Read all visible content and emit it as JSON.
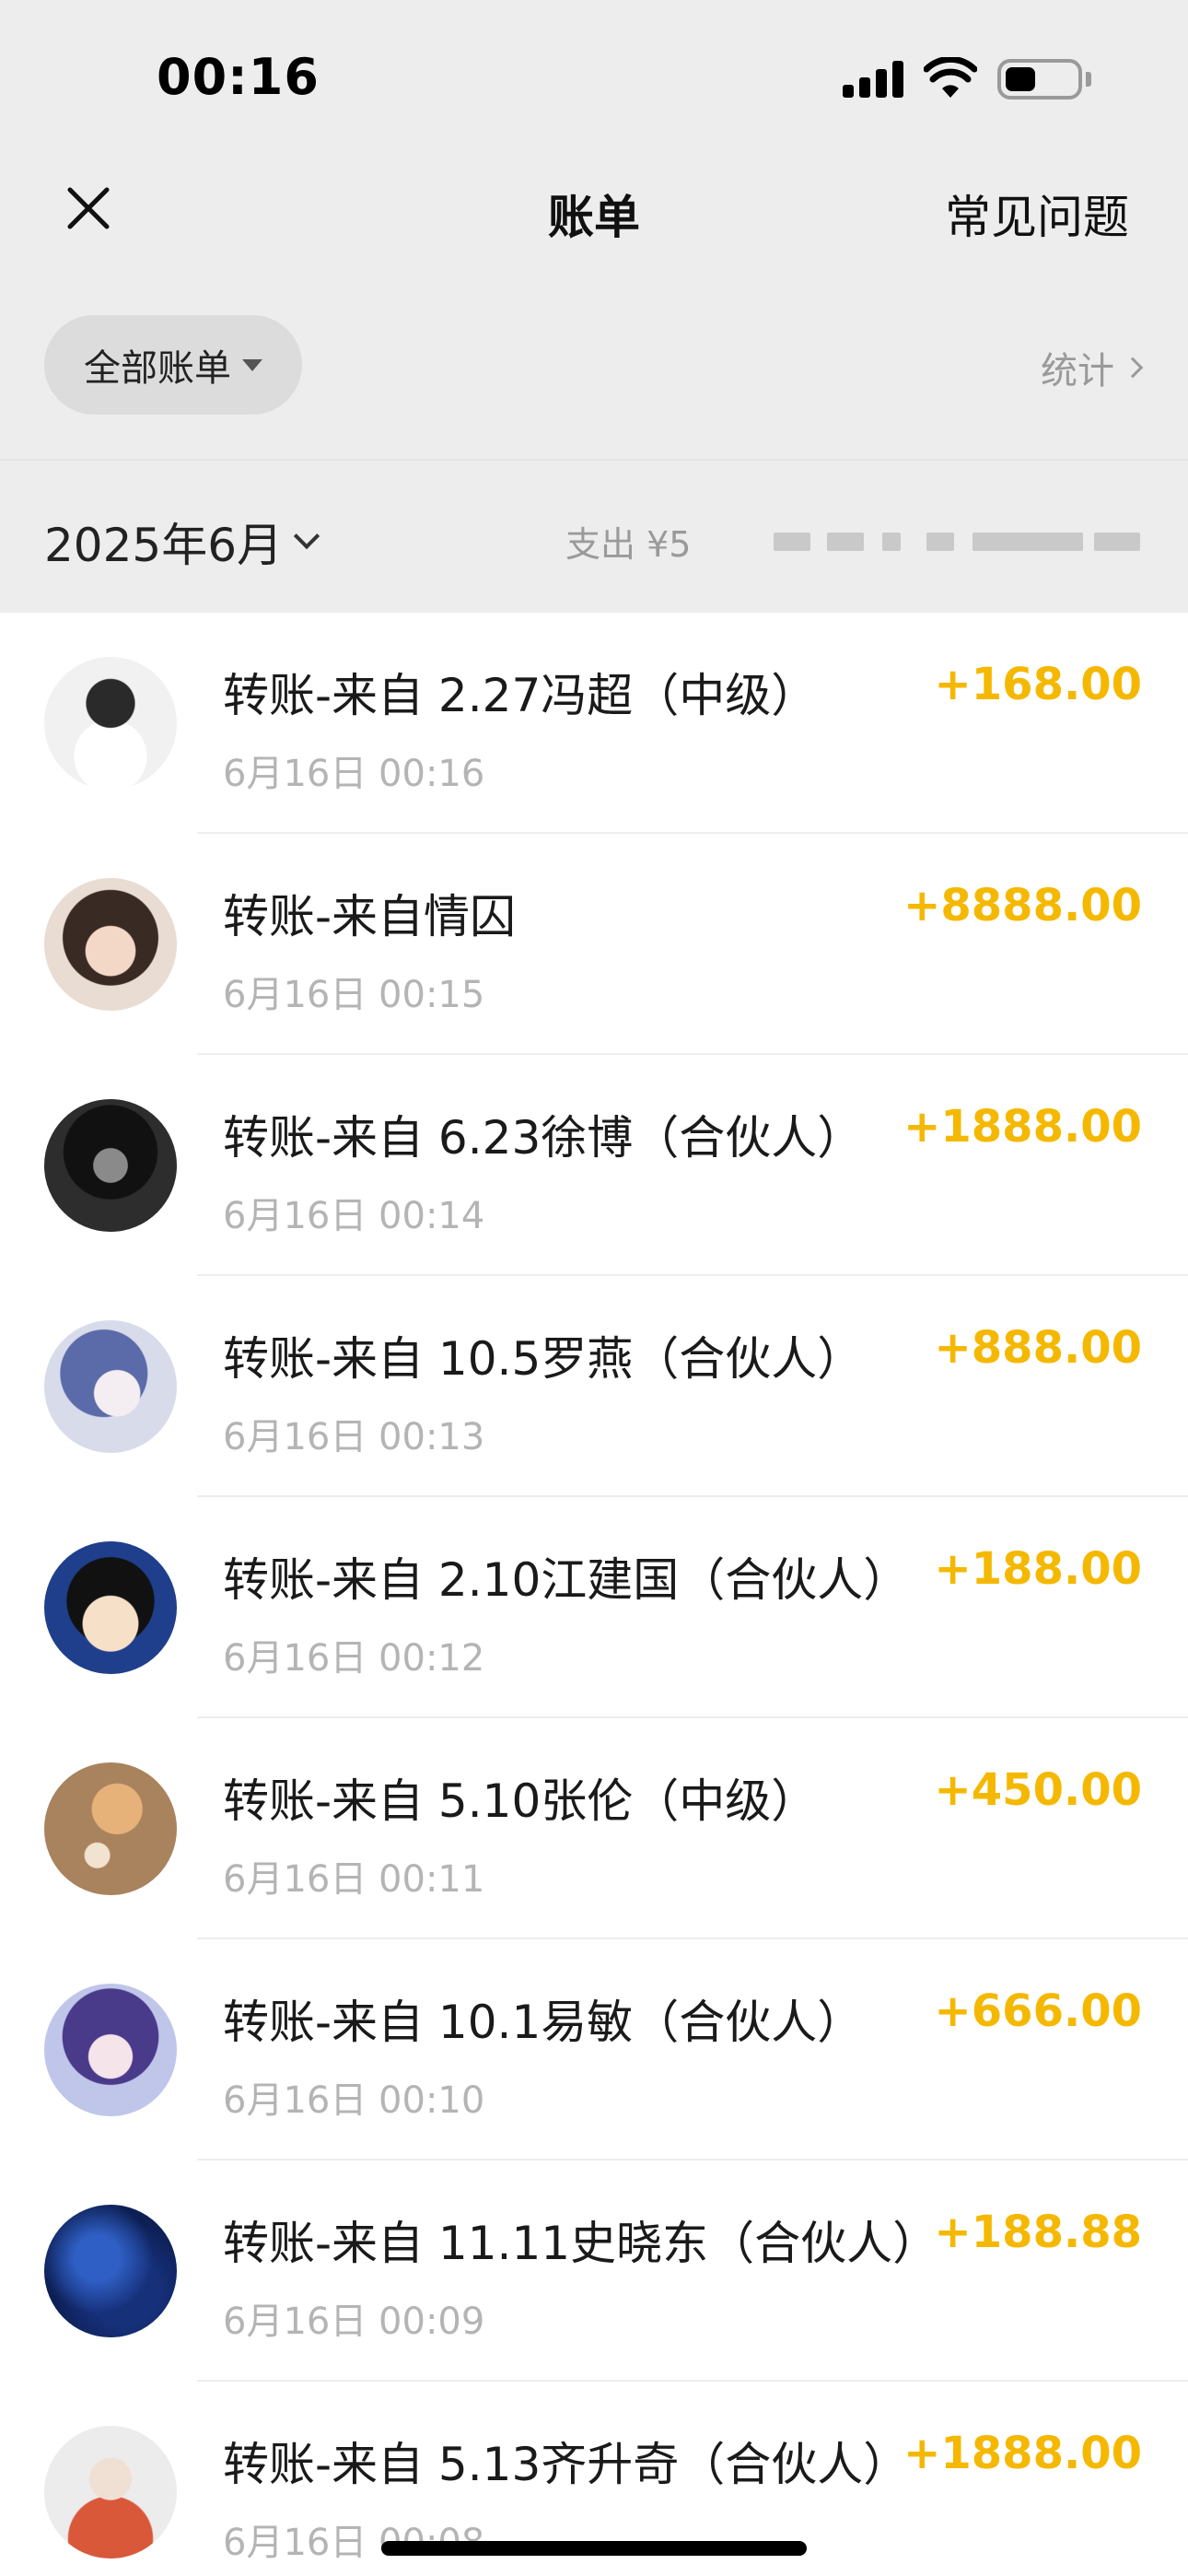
{
  "status_bar": {
    "time": "00:16"
  },
  "nav": {
    "title": "账单",
    "faq": "常见问题",
    "close_icon": "close-icon"
  },
  "filter": {
    "label": "全部账单",
    "stats": "统计"
  },
  "month": {
    "label": "2025年6月",
    "summary_prefix": "支出 ¥5"
  },
  "colors": {
    "amount": "#f5b800",
    "background_top": "#ededed"
  },
  "transactions": [
    {
      "title": "转账-来自 2.27冯超（中级）",
      "time": "6月16日 00:16",
      "amount": "+168.00"
    },
    {
      "title": "转账-来自情囚",
      "time": "6月16日 00:15",
      "amount": "+8888.00"
    },
    {
      "title": "转账-来自 6.23徐博（合伙人）",
      "time": "6月16日 00:14",
      "amount": "+1888.00"
    },
    {
      "title": "转账-来自 10.5罗燕（合伙人）",
      "time": "6月16日 00:13",
      "amount": "+888.00"
    },
    {
      "title": "转账-来自 2.10江建国（合伙人）",
      "time": "6月16日 00:12",
      "amount": "+188.00"
    },
    {
      "title": "转账-来自 5.10张伦（中级）",
      "time": "6月16日 00:11",
      "amount": "+450.00"
    },
    {
      "title": "转账-来自 10.1易敏（合伙人）",
      "time": "6月16日 00:10",
      "amount": "+666.00"
    },
    {
      "title": "转账-来自 11.11史晓东（合伙人）",
      "time": "6月16日 00:09",
      "amount": "+188.88"
    },
    {
      "title": "转账-来自 5.13齐升奇（合伙人）",
      "time": "6月16日 00:08",
      "amount": "+1888.00"
    }
  ]
}
